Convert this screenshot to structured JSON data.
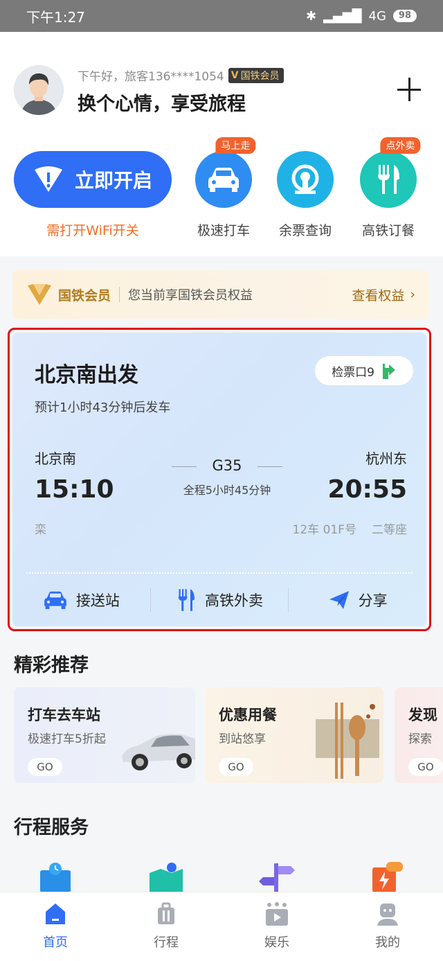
{
  "status_bar": {
    "time": "下午1:27",
    "network": "4G",
    "battery": "98"
  },
  "header": {
    "greeting": "下午好，旅客136****1054",
    "member_badge": "国铁会员",
    "slogan": "换个心情，享受旅程"
  },
  "wifi": {
    "button_label": "立即开启",
    "caption": "需打开WiFi开关"
  },
  "quick_actions": [
    {
      "label": "极速打车",
      "badge": "马上走",
      "icon": "car-icon",
      "color": "#2f8cf2"
    },
    {
      "label": "余票查询",
      "badge": "",
      "icon": "railway-logo-icon",
      "color": "#1fb2e6"
    },
    {
      "label": "高铁订餐",
      "badge": "点外卖",
      "icon": "fork-knife-icon",
      "color": "#1ec7b7"
    }
  ],
  "member_strip": {
    "title": "国铁会员",
    "text": "您当前享国铁会员权益",
    "link": "查看权益"
  },
  "trip": {
    "title": "北京南出发",
    "subtitle": "预计1小时43分钟后发车",
    "gate": "检票口9",
    "from_station": "北京南",
    "to_station": "杭州东",
    "depart_time": "15:10",
    "arrive_time": "20:55",
    "train_number": "G35",
    "duration": "全程5小时45分钟",
    "car_note": "栾",
    "car": "12车 01F号",
    "seat_class": "二等座",
    "actions": [
      "接送站",
      "高铁外卖",
      "分享"
    ]
  },
  "recommend": {
    "title": "精彩推荐",
    "cards": [
      {
        "title": "打车去车站",
        "subtitle": "极速打车5折起",
        "go": "GO"
      },
      {
        "title": "优惠用餐",
        "subtitle": "到站悠享",
        "go": "GO"
      },
      {
        "title": "发现",
        "subtitle": "探索",
        "go": "GO"
      }
    ]
  },
  "services": {
    "title": "行程服务"
  },
  "bottom_nav": [
    {
      "label": "首页",
      "active": true
    },
    {
      "label": "行程",
      "active": false
    },
    {
      "label": "娱乐",
      "active": false
    },
    {
      "label": "我的",
      "active": false
    }
  ],
  "colors": {
    "primary": "#2f6ef5",
    "orange": "#f26d22",
    "highlight_border": "#e10c18"
  }
}
